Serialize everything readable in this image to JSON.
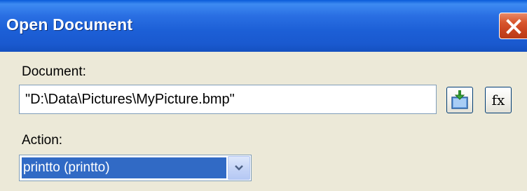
{
  "window": {
    "title": "Open Document"
  },
  "document": {
    "label": "Document:",
    "value": "\"D:\\Data\\Pictures\\MyPicture.bmp\""
  },
  "buttons": {
    "open_icon": "open-file-icon",
    "fx_label": "fx"
  },
  "action": {
    "label": "Action:",
    "selected": "printto (printto)"
  },
  "colors": {
    "titlebar": "#245edb",
    "close": "#d9572f",
    "selection": "#316ac5",
    "background": "#ece9d8"
  }
}
